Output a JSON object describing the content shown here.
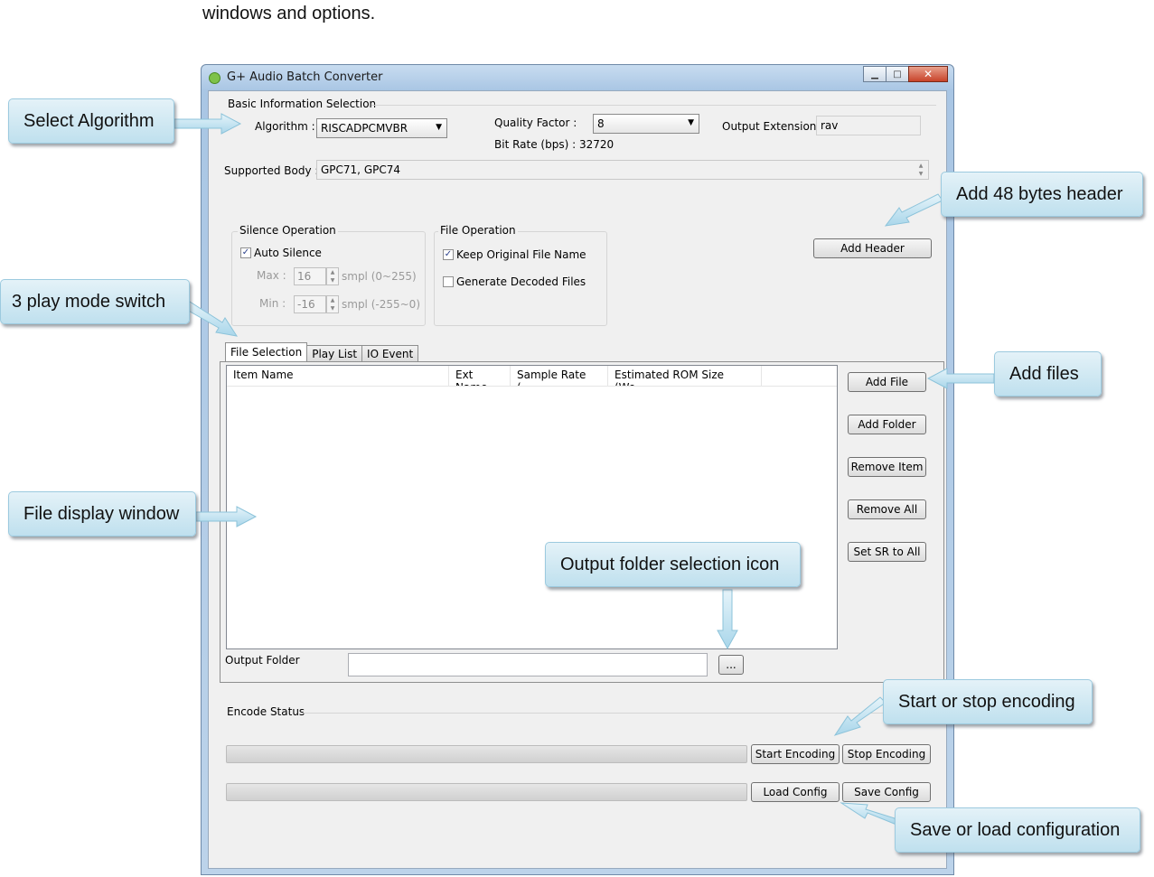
{
  "doc": {
    "intro_text": "windows and options."
  },
  "window": {
    "title": "G+ Audio Batch Converter",
    "controls": {
      "minimize": "▁",
      "maximize": "□",
      "close": "✕"
    }
  },
  "basic_info": {
    "group_title": "Basic Information Selection",
    "algorithm_label": "Algorithm :",
    "algorithm_value": "RISCADPCMVBR",
    "quality_label": "Quality Factor :",
    "quality_value": "8",
    "bitrate_text": "Bit Rate (bps) : 32720",
    "output_ext_label": "Output Extension:",
    "output_ext_value": "rav",
    "supported_body_label": "Supported Body :",
    "supported_body_value": "GPC71, GPC74"
  },
  "silence": {
    "group_title": "Silence Operation",
    "auto_silence_label": "Auto Silence",
    "auto_silence_checked": true,
    "max_label": "Max :",
    "max_value": "16",
    "max_range": "smpl (0~255)",
    "min_label": "Min :",
    "min_value": "-16",
    "min_range": "smpl (-255~0)"
  },
  "file_op": {
    "group_title": "File Operation",
    "keep_name_label": "Keep Original File Name",
    "keep_name_checked": true,
    "gen_decoded_label": "Generate Decoded Files",
    "gen_decoded_checked": false
  },
  "add_header_button": "Add Header",
  "tabs": [
    "File Selection",
    "Play List",
    "IO Event"
  ],
  "file_list": {
    "columns": [
      "Item Name",
      "Ext Name",
      "Sample Rate (...",
      "Estimated ROM Size (Wo..."
    ]
  },
  "file_buttons": {
    "add_file": "Add File",
    "add_folder": "Add Folder",
    "remove_item": "Remove Item",
    "remove_all": "Remove All",
    "set_sr": "Set SR to All"
  },
  "output_folder": {
    "label": "Output Folder",
    "value": "",
    "browse": "..."
  },
  "encode": {
    "group_title": "Encode Status",
    "start": "Start Encoding",
    "stop": "Stop Encoding",
    "load": "Load Config",
    "save": "Save Config"
  },
  "callouts": {
    "select_algorithm": "Select Algorithm",
    "add_header": "Add 48 bytes header",
    "play_mode": "3 play mode switch",
    "add_files": "Add files",
    "file_display": "File display window",
    "output_folder_icon": "Output folder selection icon",
    "start_stop": "Start or stop encoding",
    "save_load": "Save or load configuration"
  }
}
